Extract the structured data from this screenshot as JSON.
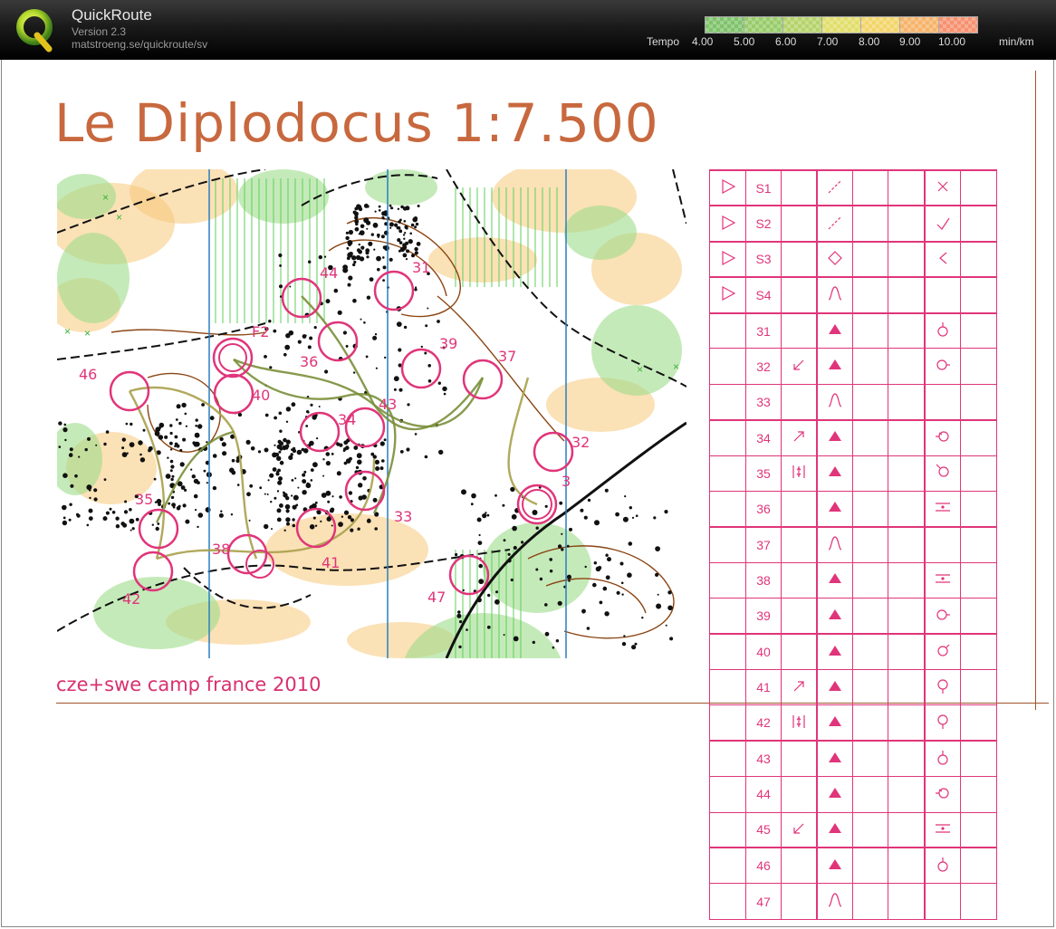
{
  "app": {
    "name": "QuickRoute",
    "version": "Version 2.3",
    "url": "matstroeng.se/quickroute/sv",
    "logo_letter": "Q"
  },
  "tempo": {
    "label": "Tempo",
    "ticks": [
      "4.00",
      "5.00",
      "6.00",
      "7.00",
      "8.00",
      "9.00",
      "10.00"
    ],
    "unit": "min/km",
    "colors": [
      "#7fc36b",
      "#98cc6a",
      "#b5d36b",
      "#e1de6c",
      "#f3d56b",
      "#f6b46b",
      "#f59270"
    ]
  },
  "map": {
    "title": "Le Diplodocus 1:7.500",
    "subtitle": "cze+swe camp france 2010",
    "control_numbers": [
      "44",
      "31",
      "F2",
      "36",
      "39",
      "37",
      "46",
      "40",
      "32",
      "34",
      "3",
      "35",
      "33",
      "38",
      "41",
      "43",
      "42",
      "47"
    ],
    "colors": {
      "control": "#e0357a",
      "contour": "#8b4513",
      "vegetation": "#9fdc8b",
      "open": "#f7c97a",
      "magnetic": "#2a7fc1"
    }
  },
  "control_descriptions": {
    "rows": [
      {
        "code": "S1",
        "start": true,
        "d": "",
        "e": "path-dashed",
        "f": "",
        "g": "x-icon",
        "h": ""
      },
      {
        "code": "S2",
        "start": true,
        "d": "",
        "e": "path-dashed",
        "f": "",
        "g": "junction-icon",
        "h": ""
      },
      {
        "code": "S3",
        "start": true,
        "d": "",
        "e": "diamond-icon",
        "f": "",
        "g": "bend-icon",
        "h": ""
      },
      {
        "code": "S4",
        "start": true,
        "d": "",
        "e": "knoll-icon",
        "f": "",
        "g": "",
        "h": ""
      },
      {
        "code": "31",
        "start": false,
        "d": "",
        "e": "boulder-icon",
        "f": "",
        "g": "top-icon",
        "h": ""
      },
      {
        "code": "32",
        "start": false,
        "d": "sw-arrow",
        "e": "boulder-icon",
        "f": "",
        "g": "east-icon",
        "h": ""
      },
      {
        "code": "33",
        "start": false,
        "d": "",
        "e": "knoll-icon",
        "f": "",
        "g": "",
        "h": ""
      },
      {
        "code": "34",
        "start": false,
        "d": "ne-arrow",
        "e": "boulder-icon",
        "f": "",
        "g": "west-icon",
        "h": ""
      },
      {
        "code": "35",
        "start": false,
        "d": "between-icon",
        "e": "boulder-icon",
        "f": "",
        "g": "nw-icon",
        "h": ""
      },
      {
        "code": "36",
        "start": false,
        "d": "",
        "e": "boulder-icon",
        "f": "",
        "g": "middle-icon",
        "h": ""
      },
      {
        "code": "37",
        "start": false,
        "d": "",
        "e": "knoll-icon",
        "f": "",
        "g": "",
        "h": ""
      },
      {
        "code": "38",
        "start": false,
        "d": "",
        "e": "boulder-icon",
        "f": "",
        "g": "middle-icon",
        "h": ""
      },
      {
        "code": "39",
        "start": false,
        "d": "",
        "e": "boulder-icon",
        "f": "",
        "g": "east-icon",
        "h": ""
      },
      {
        "code": "40",
        "start": false,
        "d": "",
        "e": "boulder-icon",
        "f": "",
        "g": "ne-icon",
        "h": ""
      },
      {
        "code": "41",
        "start": false,
        "d": "ne-arrow",
        "e": "boulder-icon",
        "f": "",
        "g": "south-icon",
        "h": ""
      },
      {
        "code": "42",
        "start": false,
        "d": "between-icon",
        "e": "boulder-icon",
        "f": "",
        "g": "south-icon",
        "h": ""
      },
      {
        "code": "43",
        "start": false,
        "d": "",
        "e": "boulder-icon",
        "f": "",
        "g": "top-icon",
        "h": ""
      },
      {
        "code": "44",
        "start": false,
        "d": "",
        "e": "boulder-icon",
        "f": "",
        "g": "west-icon",
        "h": ""
      },
      {
        "code": "45",
        "start": false,
        "d": "sw-arrow",
        "e": "boulder-icon",
        "f": "",
        "g": "middle-icon",
        "h": ""
      },
      {
        "code": "46",
        "start": false,
        "d": "",
        "e": "boulder-icon",
        "f": "",
        "g": "top-icon",
        "h": ""
      },
      {
        "code": "47",
        "start": false,
        "d": "",
        "e": "knoll-icon",
        "f": "",
        "g": "",
        "h": ""
      }
    ]
  }
}
